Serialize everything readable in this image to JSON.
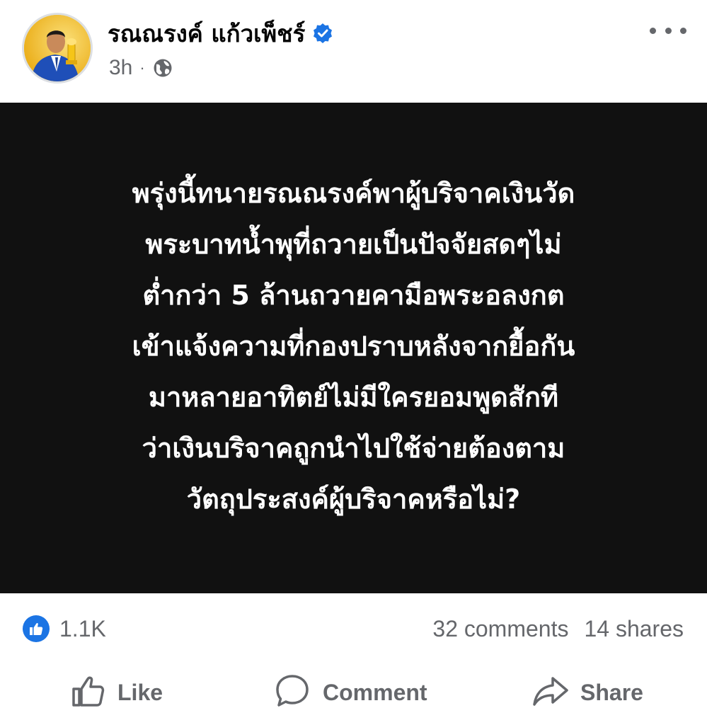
{
  "post": {
    "author": "รณณรงค์ แก้วเพ็ชร์",
    "verified": true,
    "time": "3h",
    "separator": "·",
    "visibility_icon": "globe-icon",
    "more_icon": "more-options-icon",
    "image_text_lines": [
      "พรุ่งนี้ทนายรณณรงค์พาผู้บริจาคเงินวัด",
      "พระบาทน้ำพุที่ถวายเป็นปัจจัยสดๆไม่",
      "ต่ำกว่า 5 ล้านถวายคามือพระอลงกต",
      "เข้าแจ้งความที่กองปราบหลังจากยื้อกัน",
      "มาหลายอาทิตย์ไม่มีใครยอมพูดสักที",
      "ว่าเงินบริจาคถูกนำไปใช้จ่ายต้องตาม",
      "วัตถุประสงค์ผู้บริจาคหรือไม่?"
    ]
  },
  "stats": {
    "reaction_icon": "like-reaction-icon",
    "likes": "1.1K",
    "comments": "32 comments",
    "shares": "14 shares"
  },
  "actions": {
    "like_label": "Like",
    "comment_label": "Comment",
    "share_label": "Share"
  },
  "colors": {
    "accent_blue": "#1b74e4",
    "secondary_text": "#65676b",
    "image_background": "#111111",
    "image_text": "#ffffff"
  }
}
